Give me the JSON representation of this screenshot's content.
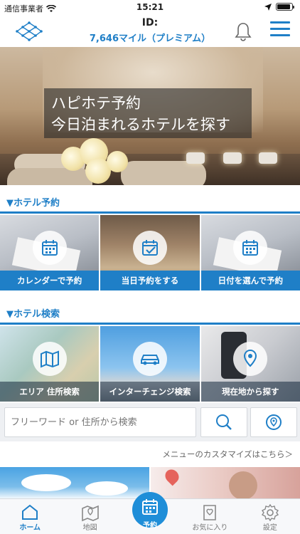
{
  "status_bar": {
    "carrier": "通信事業者",
    "time": "15:21"
  },
  "header": {
    "id_label": "ID:",
    "miles": "7,646マイル（プレミアム）"
  },
  "hero": {
    "line1": "ハピホテ予約",
    "line2": "今日泊まれるホテルを探す"
  },
  "sections": {
    "booking_heading": "▼ホテル予約",
    "search_heading": "▼ホテル検索"
  },
  "booking_tiles": [
    {
      "label": "カレンダーで予約",
      "icon": "calendar-icon"
    },
    {
      "label": "当日予約をする",
      "icon": "calendar-check-icon"
    },
    {
      "label": "日付を選んで予約",
      "icon": "calendar-icon"
    }
  ],
  "search_tiles": [
    {
      "label": "エリア 住所検索",
      "icon": "map-icon"
    },
    {
      "label": "インターチェンジ検索",
      "icon": "car-icon"
    },
    {
      "label": "現在地から探す",
      "icon": "location-pin-icon"
    }
  ],
  "search": {
    "placeholder": "フリーワード or 住所から検索"
  },
  "customize_link": "メニューのカスタマイズはこちら＞",
  "tabs": [
    {
      "label": "ホーム",
      "icon": "home-icon",
      "active": true
    },
    {
      "label": "地図",
      "icon": "map-icon",
      "active": false
    },
    {
      "label": "予約",
      "icon": "calendar-icon",
      "active": false
    },
    {
      "label": "お気に入り",
      "icon": "favorite-book-icon",
      "active": false
    },
    {
      "label": "設定",
      "icon": "gear-icon",
      "active": false
    }
  ],
  "colors": {
    "accent": "#1f7fc7",
    "tab_center": "#1f8ed8"
  }
}
